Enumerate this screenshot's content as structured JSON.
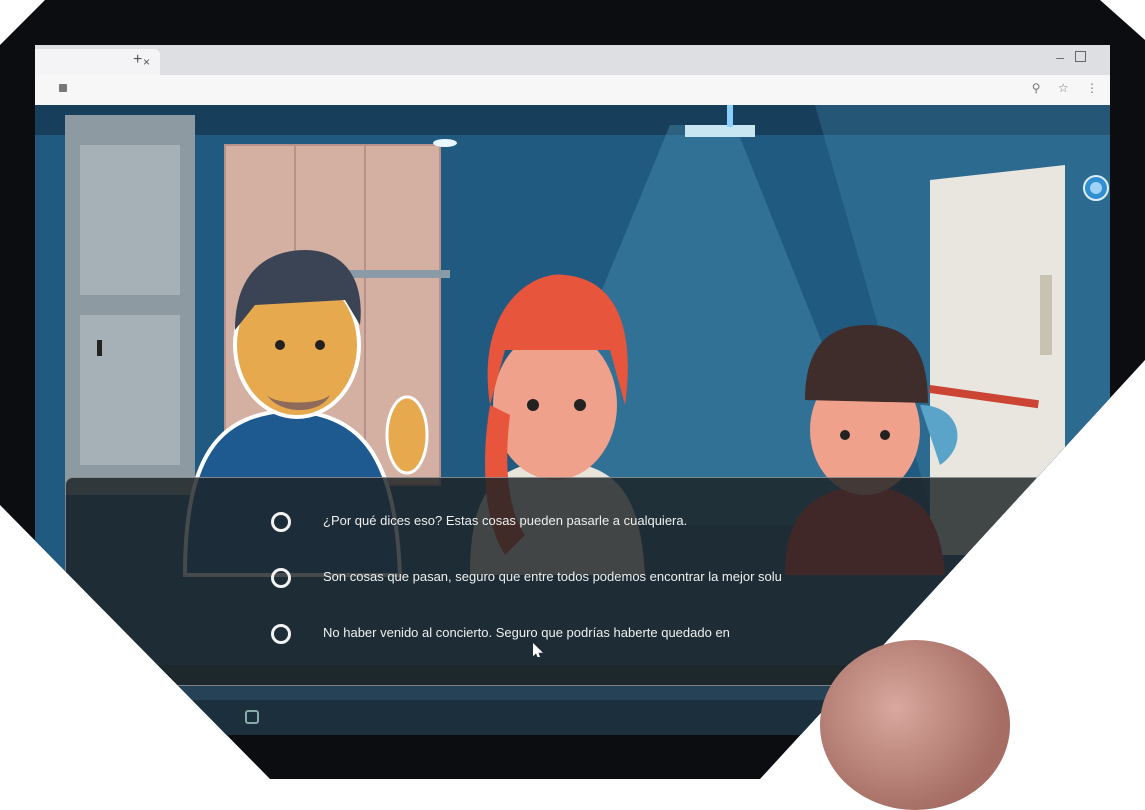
{
  "browser": {
    "tab_title": "",
    "url": "",
    "new_tab_symbol": "+",
    "tab_close_symbol": "×"
  },
  "dialogue": {
    "options": [
      {
        "label": "¿Por qué dices eso? Estas cosas pueden pasarle a cualquiera."
      },
      {
        "label": "Son cosas que pasan, seguro que entre todos podemos encontrar la mejor solu"
      },
      {
        "label": "No haber venido al concierto. Seguro que podrías haberte quedado en"
      }
    ]
  },
  "icons": {
    "language": "globe-icon",
    "cursor": "mouse-pointer-icon"
  },
  "colors": {
    "scene_background": "#1f4d6e",
    "dialog_background": "#1c2224",
    "accent_blue": "#2f8fd0"
  }
}
